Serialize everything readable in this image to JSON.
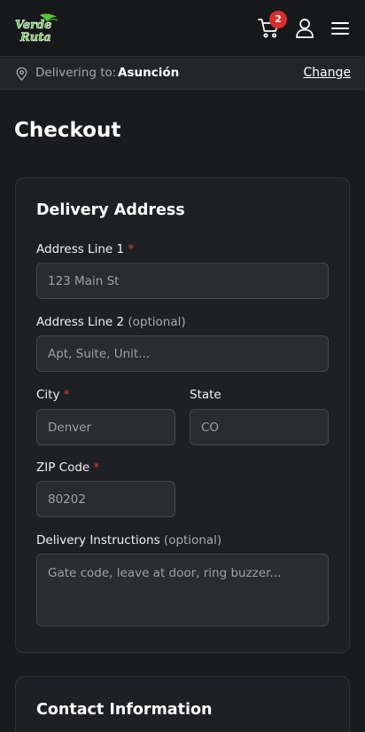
{
  "header": {
    "logo_text": "Verde Ruta",
    "cart_count": "2"
  },
  "delivery_bar": {
    "label": "Delivering to:",
    "city": "Asunción",
    "change_label": "Change"
  },
  "page_title": "Checkout",
  "delivery_address": {
    "title": "Delivery Address",
    "address1": {
      "label": "Address Line 1",
      "required_mark": "*",
      "placeholder": "123 Main St"
    },
    "address2": {
      "label": "Address Line 2",
      "optional_text": "(optional)",
      "placeholder": "Apt, Suite, Unit..."
    },
    "city": {
      "label": "City",
      "required_mark": "*",
      "placeholder": "Denver"
    },
    "state": {
      "label": "State",
      "placeholder": "CO"
    },
    "zip": {
      "label": "ZIP Code",
      "required_mark": "*",
      "placeholder": "80202"
    },
    "instructions": {
      "label": "Delivery Instructions",
      "optional_text": "(optional)",
      "placeholder": "Gate code, leave at door, ring buzzer..."
    }
  },
  "contact_information": {
    "title": "Contact Information"
  },
  "colors": {
    "background": "#1a1b1d",
    "card": "#1f2023",
    "input": "#2a2c30",
    "required": "#e03c3c",
    "badge": "#d92d2d",
    "logo_green": "#5cc63c"
  }
}
